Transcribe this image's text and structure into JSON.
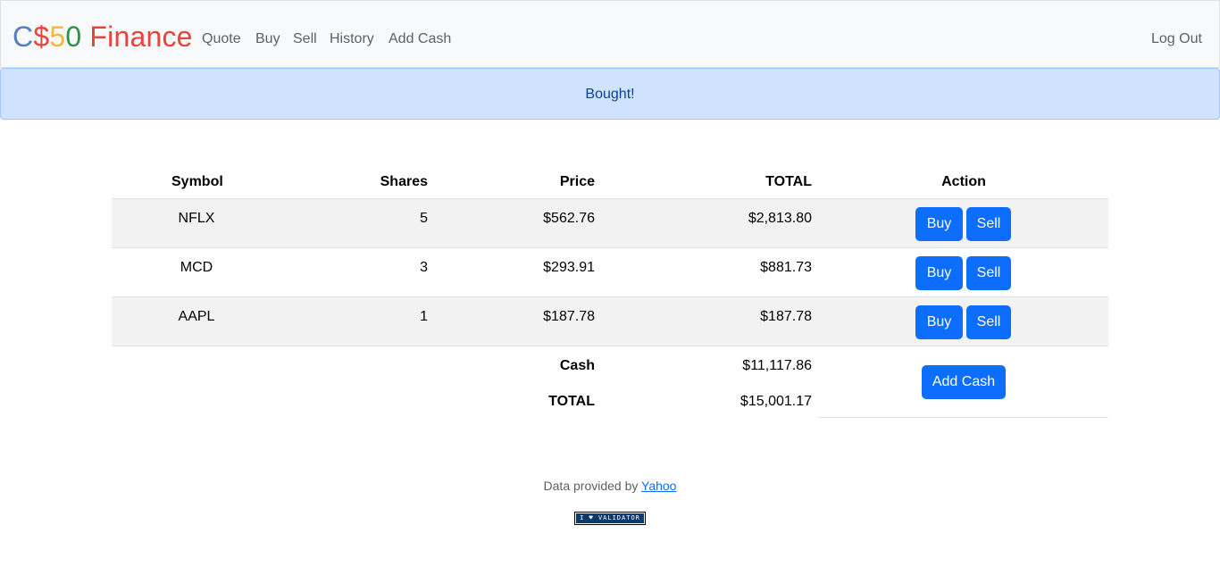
{
  "brand": {
    "c": "C",
    "dollar": "$",
    "five": "5",
    "zero": "0",
    "finance": " Finance"
  },
  "nav": {
    "quote": "Quote",
    "buy": "Buy",
    "sell": "Sell",
    "history": "History",
    "add_cash": "Add Cash",
    "logout": "Log Out"
  },
  "alert": {
    "message": "Bought!"
  },
  "table": {
    "headers": {
      "symbol": "Symbol",
      "shares": "Shares",
      "price": "Price",
      "total": "TOTAL",
      "action": "Action"
    },
    "rows": [
      {
        "symbol": "NFLX",
        "shares": "5",
        "price": "$562.76",
        "total": "$2,813.80",
        "buy": "Buy",
        "sell": "Sell"
      },
      {
        "symbol": "MCD",
        "shares": "3",
        "price": "$293.91",
        "total": "$881.73",
        "buy": "Buy",
        "sell": "Sell"
      },
      {
        "symbol": "AAPL",
        "shares": "1",
        "price": "$187.78",
        "total": "$187.78",
        "buy": "Buy",
        "sell": "Sell"
      }
    ],
    "cash_label": "Cash",
    "cash_value": "$11,117.86",
    "grand_total_label": "TOTAL",
    "grand_total_value": "$15,001.17",
    "add_cash_button": "Add Cash"
  },
  "footer": {
    "prefix": "Data provided by ",
    "link": "Yahoo",
    "validator_badge": "I ♥ VALIDATOR"
  },
  "colors": {
    "primary": "#0d6efd",
    "alert_bg": "#cfe2ff",
    "alert_text": "#084298",
    "brand_blue": "#537fbe",
    "brand_red": "#ea433b",
    "brand_yellow": "#f5b82e",
    "brand_green": "#2e944b"
  }
}
